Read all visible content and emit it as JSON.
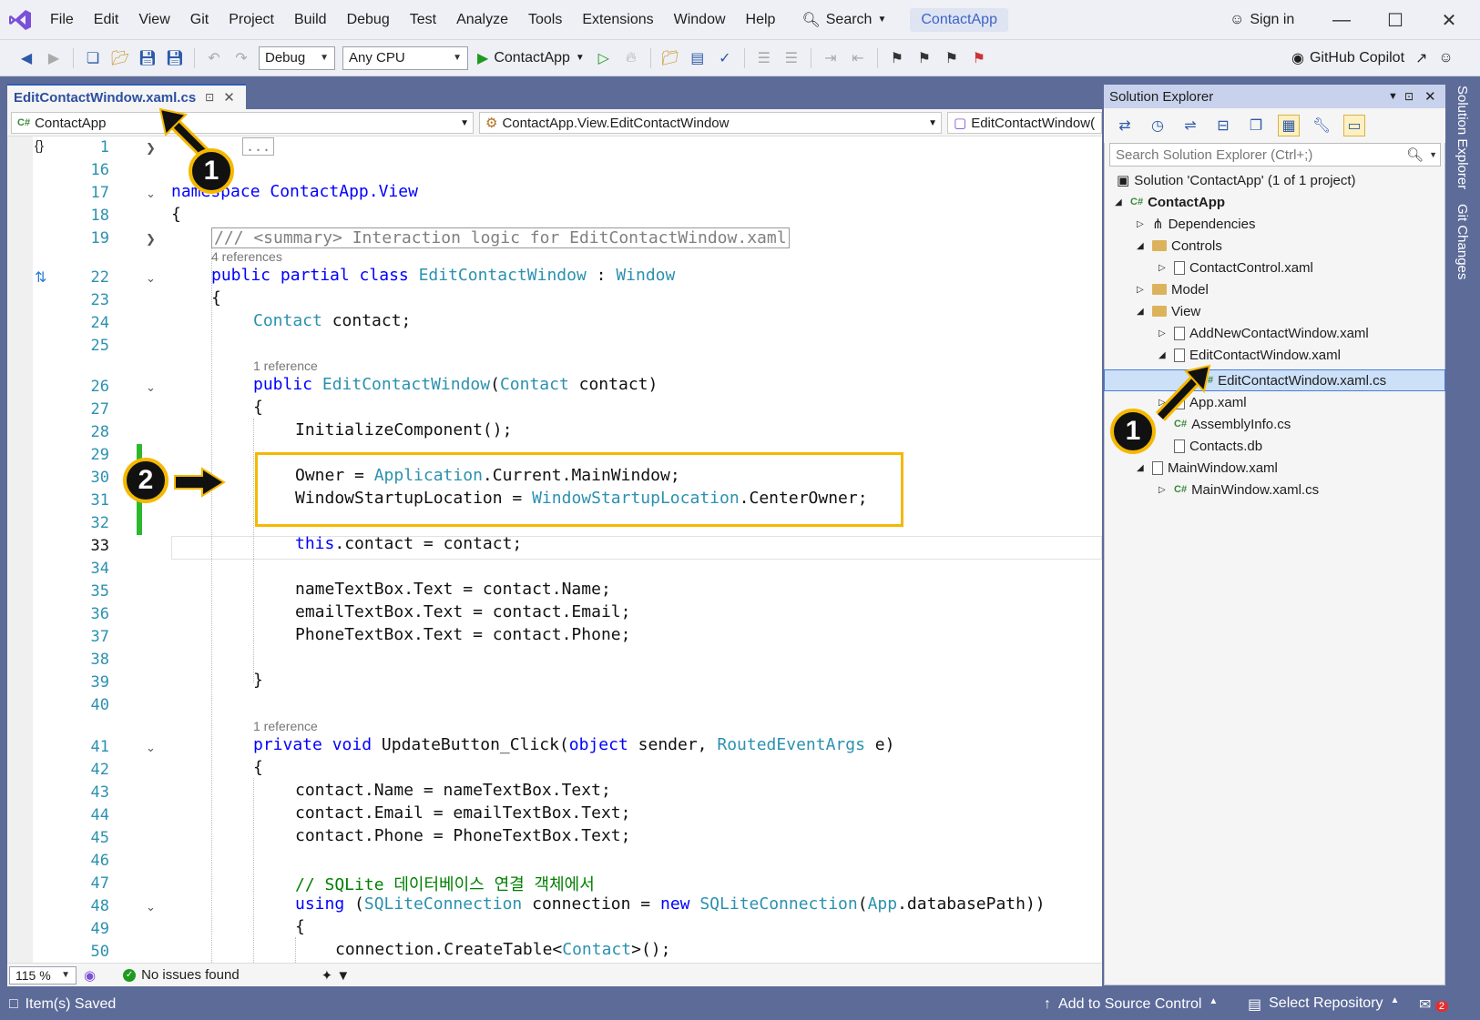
{
  "menu": [
    "File",
    "Edit",
    "View",
    "Git",
    "Project",
    "Build",
    "Debug",
    "Test",
    "Analyze",
    "Tools",
    "Extensions",
    "Window",
    "Help"
  ],
  "search_label": "Search",
  "app_title": "ContactApp",
  "sign_in": "Sign in",
  "toolbar": {
    "config": "Debug",
    "platform": "Any CPU",
    "run_label": "ContactApp",
    "copilot": "GitHub Copilot"
  },
  "doc_tab": "EditContactWindow.xaml.cs",
  "nav": {
    "project": "ContactApp",
    "class": "ContactApp.View.EditContactWindow",
    "member": "EditContactWindow("
  },
  "code": {
    "l1_collapsed": "...",
    "l17": "namespace ContactApp.View",
    "summary": "/// <summary> Interaction logic for EditContactWindow.xaml",
    "refs4": "4 references",
    "class_decl_kw": "public partial class ",
    "class_name": "EditContactWindow",
    "class_base": "Window",
    "field_type": "Contact",
    "field_name": " contact;",
    "ref1": "1 reference",
    "ctor_kw": "public ",
    "ctor_name": "EditContactWindow",
    "ctor_param_type": "Contact",
    "ctor_param": " contact)",
    "init": "InitializeComponent();",
    "owner_a": "Owner = ",
    "owner_b": "Application",
    "owner_c": ".Current.MainWindow;",
    "wsl_a": "WindowStartupLocation = ",
    "wsl_b": "WindowStartupLocation",
    "wsl_c": ".CenterOwner;",
    "this_kw": "this",
    "this_rest": ".contact = contact;",
    "l35": "nameTextBox.Text = contact.Name;",
    "l36": "emailTextBox.Text = contact.Email;",
    "l37": "PhoneTextBox.Text = contact.Phone;",
    "ref1b": "1 reference",
    "upd_kw": "private void ",
    "upd_name": "UpdateButton_Click(",
    "upd_obj": "object",
    "upd_mid": " sender, ",
    "upd_type": "RoutedEventArgs",
    "upd_end": " e)",
    "l43": "contact.Name = nameTextBox.Text;",
    "l44": "contact.Email = emailTextBox.Text;",
    "l45": "contact.Phone = PhoneTextBox.Text;",
    "l47": "// SQLite 데이터베이스 연결 객체에서",
    "using_kw": "using",
    "using_a": " (",
    "using_t1": "SQLiteConnection",
    "using_b": " connection = ",
    "using_new": "new",
    "using_t2": "SQLiteConnection",
    "using_app": "App",
    "using_c": ".databasePath))",
    "l50a": "connection.CreateTable<",
    "l50t": "Contact",
    "l50b": ">();",
    "brace_open": "{",
    "brace_close": "}"
  },
  "line_numbers": [
    "1",
    "16",
    "17",
    "18",
    "19",
    "22",
    "23",
    "24",
    "25",
    "26",
    "27",
    "28",
    "29",
    "30",
    "31",
    "32",
    "33",
    "34",
    "35",
    "36",
    "37",
    "38",
    "39",
    "40",
    "41",
    "42",
    "43",
    "44",
    "45",
    "46",
    "47",
    "48",
    "49",
    "50"
  ],
  "editor_status": {
    "zoom": "115 %",
    "issues": "No issues found"
  },
  "solution_explorer": {
    "title": "Solution Explorer",
    "search_placeholder": "Search Solution Explorer (Ctrl+;)",
    "items": [
      "Solution 'ContactApp' (1 of 1 project)",
      "ContactApp",
      "Dependencies",
      "Controls",
      "ContactControl.xaml",
      "Model",
      "View",
      "AddNewContactWindow.xaml",
      "EditContactWindow.xaml",
      "EditContactWindow.xaml.cs",
      "App.xaml",
      "AssemblyInfo.cs",
      "Contacts.db",
      "MainWindow.xaml",
      "MainWindow.xaml.cs"
    ]
  },
  "side_tabs": [
    "Solution Explorer",
    "Git Changes"
  ],
  "statusbar": {
    "left": "Item(s) Saved",
    "source": "Add to Source Control",
    "repo": "Select Repository",
    "notif": "2"
  },
  "callouts": [
    "1",
    "1",
    "2"
  ],
  "colors": {
    "accent": "#f5b800",
    "chrome": "#5d6b99",
    "keyword": "#0000ff",
    "type": "#2b91af"
  }
}
